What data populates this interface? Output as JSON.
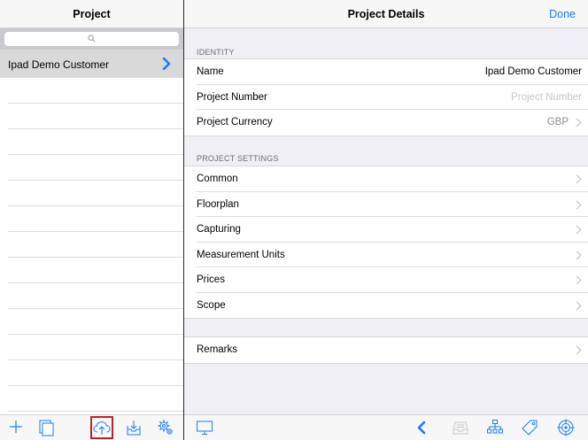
{
  "left_pane": {
    "title": "Project",
    "search": {
      "placeholder": ""
    },
    "projects": [
      {
        "label": "Ipad Demo Customer",
        "selected": true
      }
    ],
    "empty_row_count": 14,
    "toolbar": {
      "icons": [
        "plus-icon",
        "copy-icon",
        "cloud-upload-icon",
        "download-tray-icon",
        "settings-gears-icon"
      ],
      "highlighted": "cloud-upload-icon"
    }
  },
  "right_pane": {
    "title": "Project Details",
    "done_label": "Done",
    "identity": {
      "header": "IDENTITY",
      "name_label": "Name",
      "name_value": "Ipad Demo Customer",
      "number_label": "Project Number",
      "number_placeholder": "Project Number",
      "currency_label": "Project Currency",
      "currency_value": "GBP"
    },
    "settings": {
      "header": "PROJECT SETTINGS",
      "items": [
        "Common",
        "Floorplan",
        "Capturing",
        "Measurement Units",
        "Prices",
        "Scope"
      ]
    },
    "remarks_label": "Remarks",
    "toolbar": {
      "icons": [
        "monitor-icon",
        "back-chevron-icon",
        "tray-icon",
        "hierarchy-icon",
        "tag-icon",
        "target-icon"
      ]
    }
  },
  "colors": {
    "accent": "#147efb",
    "highlight_border": "#c0222a",
    "grouped_background": "#efeff4",
    "selected_row": "#d9d9d9"
  }
}
